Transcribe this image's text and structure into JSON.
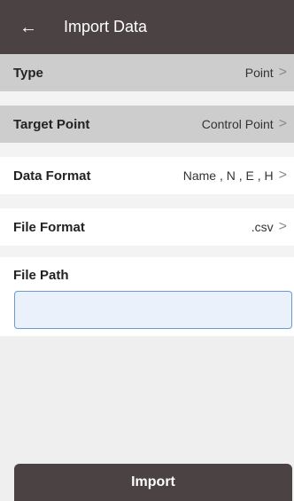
{
  "header": {
    "back_icon": "arrow-left-icon",
    "title": "Import Data"
  },
  "rows": [
    {
      "label": "Type",
      "value": "Point"
    },
    {
      "label": "Target Point",
      "value": "Control Point"
    },
    {
      "label": "Data Format",
      "value": "Name , N , E , H"
    },
    {
      "label": "File Format",
      "value": ".csv"
    }
  ],
  "file_path": {
    "label": "File Path",
    "value": "",
    "placeholder": ""
  },
  "import_button": {
    "label": "Import"
  },
  "colors": {
    "header_bg": "#4b4343",
    "selected_row_bg": "#cdcdcd",
    "input_border": "#6c9ad0"
  }
}
